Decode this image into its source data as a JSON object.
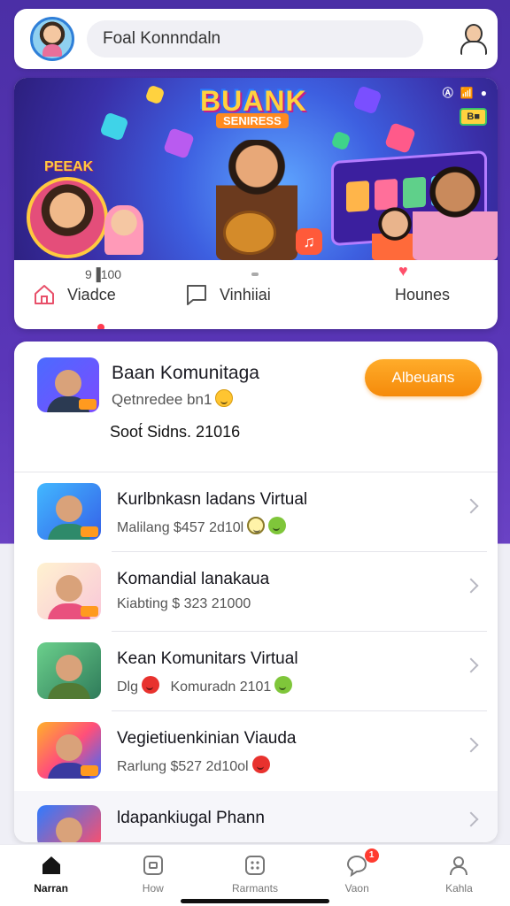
{
  "topbar": {
    "search_text": "Foal Konnndaln"
  },
  "hero": {
    "logo_title": "BUANK",
    "logo_subtitle": "SENIRESS",
    "tag_left": "PEEAK",
    "status_icons": [
      "Ⓐ",
      "📶",
      "●"
    ],
    "badge": "B■",
    "count_label": "9▐100",
    "nav": [
      {
        "label": "Viadce",
        "icon": "home-icon"
      },
      {
        "label": "Vinhiiai",
        "icon": "square-chat-icon"
      },
      {
        "label": "Hounes",
        "icon": "heart-icon"
      }
    ]
  },
  "featured": {
    "title": "Baan Komunitaga",
    "subtitle": "Qetnredee bn1",
    "meta": "Soot́ Sidns. 21016",
    "join_label": "Albeuans"
  },
  "list": [
    {
      "title": "Kurlbnkasn ladans Virtual",
      "subtitle": "Malilang $457 2d10l"
    },
    {
      "title": "Komandial lanakaua",
      "subtitle": "Kiabting $ 323 21000"
    },
    {
      "title": "Kean Komunitars Virtual",
      "subtitle": "Dlg",
      "subtitle2": "Komuradn 2101"
    },
    {
      "title": "Vegietiuenkinian Viauda",
      "subtitle": "Rarlung $527 2d10ol"
    },
    {
      "title": "ldapankiugal Phann",
      "subtitle": ""
    }
  ],
  "bottom_nav": [
    {
      "label": "Narran",
      "icon": "home-icon",
      "active": true
    },
    {
      "label": "How",
      "icon": "window-icon",
      "active": false
    },
    {
      "label": "Rarmants",
      "icon": "dots-grid-icon",
      "active": false
    },
    {
      "label": "Vaon",
      "icon": "chat-bubble-icon",
      "active": false,
      "badge": "1"
    },
    {
      "label": "Kahla",
      "icon": "person-icon",
      "active": false
    }
  ],
  "colors": {
    "background_top": "#4b2fa6",
    "accent_orange": "#f58a0a",
    "notification_red": "#ff3b30"
  }
}
